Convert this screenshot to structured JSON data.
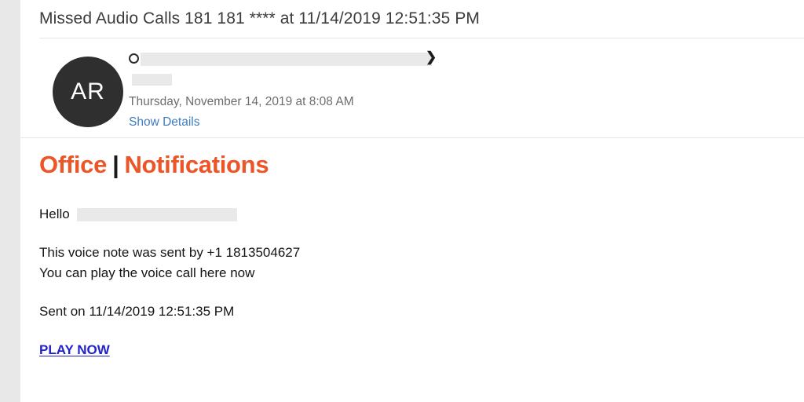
{
  "message": {
    "subject": "Missed Audio Calls 181 181 **** at 11/14/2019 12:51:35 PM",
    "sender": {
      "avatar_initials": "AR",
      "name_redacted": "",
      "address_redacted": "",
      "expand_icon": "❯",
      "date": "Thursday, November 14, 2019 at 8:08 AM",
      "show_details_label": "Show Details"
    }
  },
  "email_body": {
    "brand": {
      "primary": "Office",
      "separator": "|",
      "secondary": "Notifications",
      "accent_color": "#ec5527"
    },
    "greeting": {
      "label": "Hello",
      "recipient_redacted": ""
    },
    "lines": [
      "This voice note was sent by +1 1813504627",
      "You can play the voice call here now",
      "Sent on 11/14/2019 12:51:35 PM"
    ],
    "cta": {
      "label": "PLAY NOW",
      "color": "#2222cc"
    }
  }
}
